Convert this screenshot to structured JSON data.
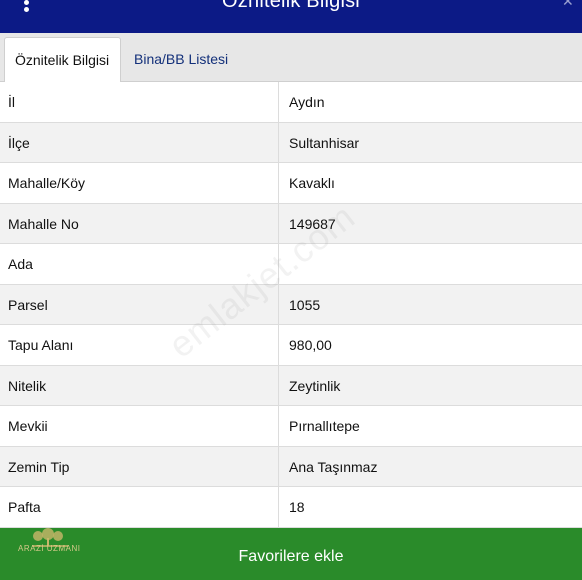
{
  "header": {
    "title": "Öznitelik Bilgisi",
    "menu_icon": "kebab-menu-icon",
    "close_icon": "close-icon"
  },
  "tabs": [
    {
      "label": "Öznitelik Bilgisi",
      "active": true
    },
    {
      "label": "Bina/BB Listesi",
      "active": false
    }
  ],
  "rows": [
    {
      "label": "İl",
      "value": "Aydın"
    },
    {
      "label": "İlçe",
      "value": "Sultanhisar"
    },
    {
      "label": "Mahalle/Köy",
      "value": "Kavaklı"
    },
    {
      "label": "Mahalle No",
      "value": "149687"
    },
    {
      "label": "Ada",
      "value": ""
    },
    {
      "label": "Parsel",
      "value": "1055"
    },
    {
      "label": "Tapu Alanı",
      "value": "980,00"
    },
    {
      "label": "Nitelik",
      "value": "Zeytinlik"
    },
    {
      "label": "Mevkii",
      "value": "Pırnallıtepe"
    },
    {
      "label": "Zemin Tip",
      "value": "Ana Taşınmaz"
    },
    {
      "label": "Pafta",
      "value": "18"
    }
  ],
  "watermark": "emlakjet.com",
  "footer": {
    "button_label": "Favorilere ekle",
    "logo_text": "ARAZİ UZMANI"
  },
  "colors": {
    "header_bg": "#0c1a86",
    "footer_bg": "#2a8b2a",
    "tab_inactive_text": "#13307a"
  }
}
